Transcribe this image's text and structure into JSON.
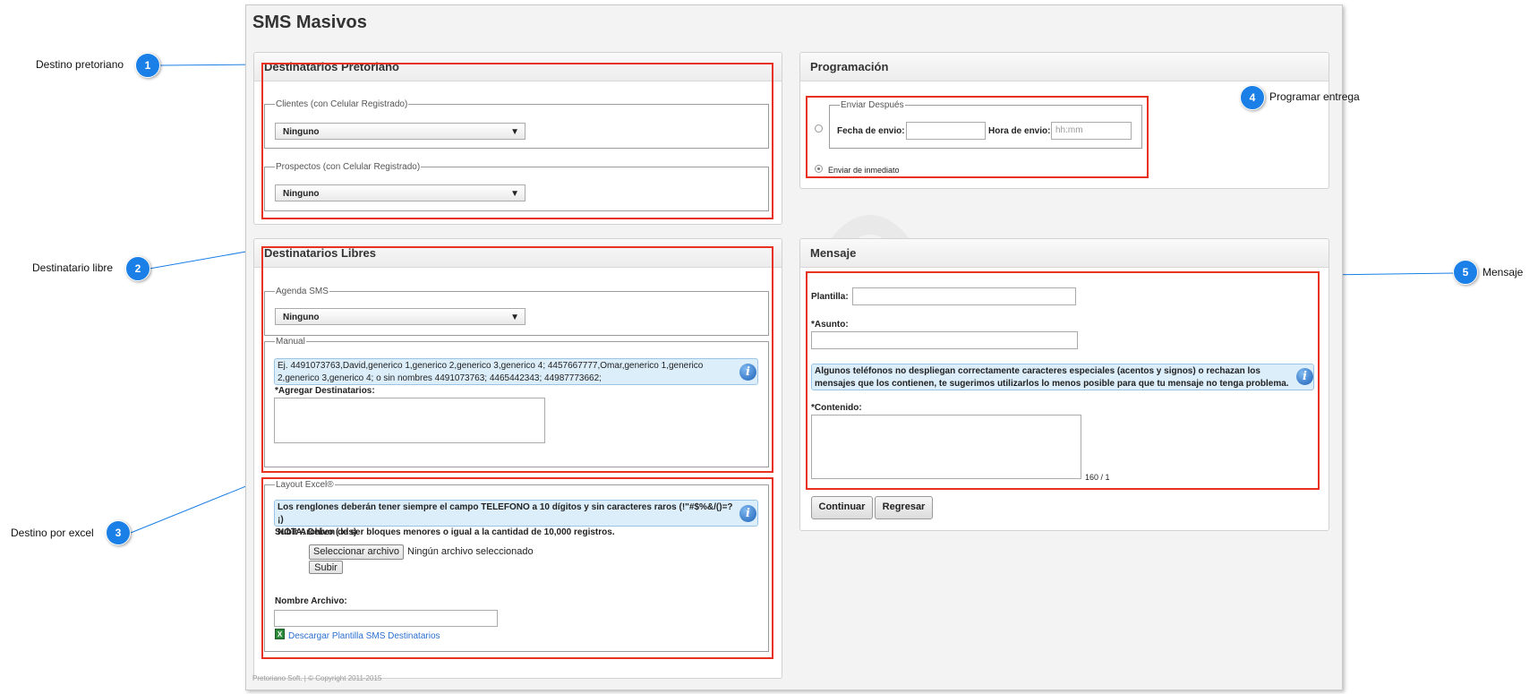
{
  "app": {
    "title": "SMS Masivos",
    "footer": "Pretoriano Soft. | © Copyright 2011-2015"
  },
  "destinatarios_pretoriano": {
    "heading": "Destinatarios Pretoriano",
    "clientes_legend": "Clientes (con Celular Registrado)",
    "clientes_value": "Ninguno",
    "prospectos_legend": "Prospectos (con Celular Registrado)",
    "prospectos_value": "Ninguno"
  },
  "destinatarios_libres": {
    "heading": "Destinatarios Libres",
    "agenda_legend": "Agenda SMS",
    "agenda_value": "Ninguno",
    "manual_legend": "Manual",
    "manual_info": "Ej. 4491073763,David,generico 1,generico 2,generico 3,generico 4; 4457667777,Omar,generico 1,generico 2,generico 3,generico 4; o sin nombres 4491073763; 4465442343; 44987773662;",
    "agregar_label": "*Agregar Destinatarios:",
    "excel_legend": "Layout Excel®",
    "excel_info_line1": "Los renglones deberán tener siempre el campo TELEFONO a 10 dígitos y sin caracteres raros (!\"#$%&/()=?¡)",
    "excel_info_line2": "NOTA: Deben de ser bloques menores o igual a la cantidad de 10,000 registros.",
    "subir_archivo_label": "Subir Archivo (.xls)",
    "seleccionar_button": "Seleccionar archivo",
    "no_file_text": "Ningún archivo seleccionado",
    "subir_button": "Subir",
    "nombre_archivo_label": "Nombre Archivo:",
    "descargar_link": "Descargar Plantilla SMS Destinatarios"
  },
  "programacion": {
    "heading": "Programación",
    "enviar_despues_legend": "Enviar Después",
    "fecha_label": "Fecha de envio:",
    "fecha_value": "",
    "hora_label": "Hora de envio:",
    "hora_placeholder": "hh:mm",
    "enviar_inmediato_label": "Enviar de inmediato"
  },
  "mensaje": {
    "heading": "Mensaje",
    "plantilla_label": "Plantilla:",
    "asunto_label": "*Asunto:",
    "info": "Algunos teléfonos no despliegan correctamente caracteres especiales (acentos y signos) o rechazan los mensajes que los contienen, te sugerimos utilizarlos lo menos posible para que tu mensaje no tenga problema.",
    "contenido_label": "*Contenido:",
    "counter": "160 / 1",
    "continuar_button": "Continuar",
    "regresar_button": "Regresar"
  },
  "callouts": [
    {
      "number": "1",
      "label": "Destino pretoriano"
    },
    {
      "number": "2",
      "label": "Destinatario libre"
    },
    {
      "number": "3",
      "label": "Destino por excel"
    },
    {
      "number": "4",
      "label": "Programar entrega"
    },
    {
      "number": "5",
      "label": "Mensaje"
    }
  ],
  "colors": {
    "callout_badge": "#1a7fe6",
    "highlight_box": "#e8321f",
    "info_background": "#dceefa",
    "link": "#2b6fd1"
  }
}
